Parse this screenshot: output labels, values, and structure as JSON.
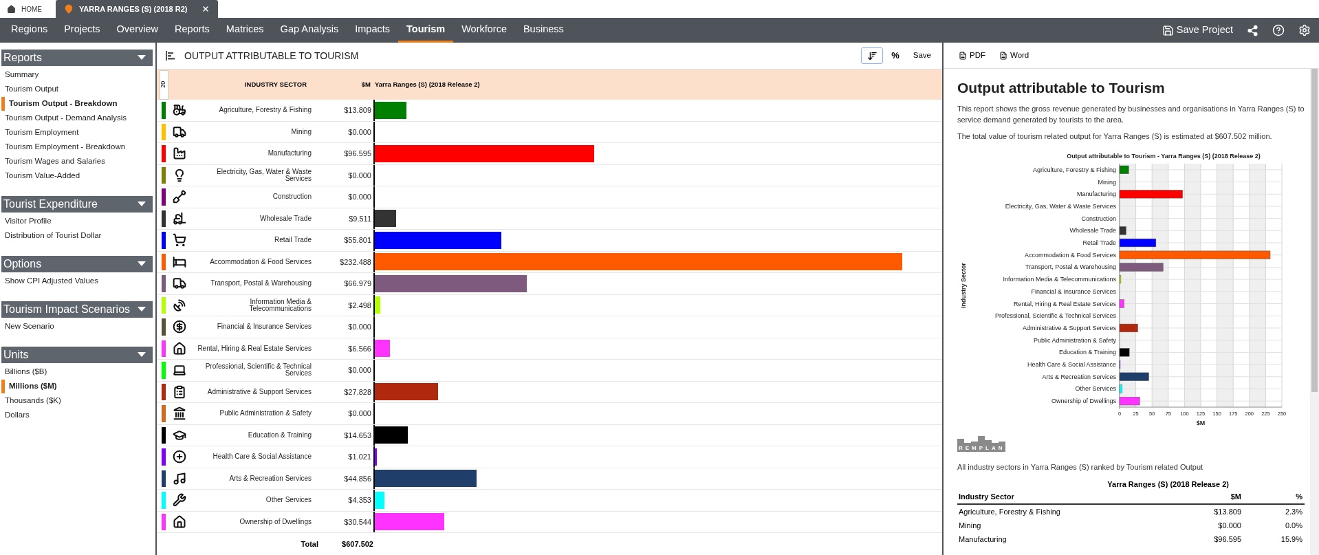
{
  "tabs": [
    {
      "label": "HOME",
      "selected": false
    },
    {
      "label": "YARRA RANGES (S) (2018 R2)",
      "selected": true
    }
  ],
  "nav": {
    "items": [
      {
        "label": "Regions",
        "selected": false
      },
      {
        "label": "Projects",
        "selected": false
      },
      {
        "label": "Overview",
        "selected": false
      },
      {
        "label": "Reports",
        "selected": false
      },
      {
        "label": "Matrices",
        "selected": false
      },
      {
        "label": "Gap Analysis",
        "selected": false
      },
      {
        "label": "Impacts",
        "selected": false
      },
      {
        "label": "Tourism",
        "selected": true
      },
      {
        "label": "Workforce",
        "selected": false
      },
      {
        "label": "Business",
        "selected": false
      }
    ],
    "save_project": "Save Project"
  },
  "sidebar": {
    "sections": [
      {
        "title": "Reports",
        "items": [
          {
            "label": "Summary",
            "selected": false
          },
          {
            "label": "Tourism Output",
            "selected": false
          },
          {
            "label": "Tourism Output - Breakdown",
            "selected": true
          },
          {
            "label": "Tourism Output - Demand Analysis",
            "selected": false
          },
          {
            "label": "Tourism Employment",
            "selected": false
          },
          {
            "label": "Tourism Employment - Breakdown",
            "selected": false
          },
          {
            "label": "Tourism Wages and Salaries",
            "selected": false
          },
          {
            "label": "Tourism Value-Added",
            "selected": false
          }
        ]
      },
      {
        "title": "Tourist Expenditure",
        "items": [
          {
            "label": "Visitor Profile",
            "selected": false
          },
          {
            "label": "Distribution of Tourist Dollar",
            "selected": false
          }
        ]
      },
      {
        "title": "Options",
        "items": [
          {
            "label": "Show CPI Adjusted Values",
            "selected": false
          }
        ]
      },
      {
        "title": "Tourism Impact Scenarios",
        "items": [
          {
            "label": "New Scenario",
            "selected": false
          }
        ]
      },
      {
        "title": "Units",
        "items": [
          {
            "label": "Billions ($B)",
            "selected": false
          },
          {
            "label": "Millions ($M)",
            "selected": true
          },
          {
            "label": "Thousands ($K)",
            "selected": false
          },
          {
            "label": "Dollars",
            "selected": false
          }
        ]
      }
    ]
  },
  "report": {
    "title": "OUTPUT ATTRIBUTABLE TO TOURISM",
    "sort": {
      "selected": true
    },
    "percent": "%",
    "save": "Save",
    "table": {
      "index": "20",
      "columns": [
        "INDUSTRY SECTOR",
        "$M",
        "Yarra Ranges (S) (2018 Release 2)"
      ],
      "rows": [
        {
          "sector": "Agriculture, Forestry & Fishing",
          "value": "$13.809",
          "color": "#008000",
          "level": 0.0552
        },
        {
          "sector": "Mining",
          "value": "$0.000",
          "color": "#ffc000",
          "level": 0
        },
        {
          "sector": "Manufacturing",
          "value": "$96.595",
          "color": "#ff0000",
          "level": 0.3864
        },
        {
          "sector": "Electricity, Gas, Water & Waste Services",
          "value": "$0.000",
          "color": "#808000",
          "level": 0
        },
        {
          "sector": "Construction",
          "value": "$0.000",
          "color": "#800080",
          "level": 0
        },
        {
          "sector": "Wholesale Trade",
          "value": "$9.511",
          "color": "#333333",
          "level": 0.038
        },
        {
          "sector": "Retail Trade",
          "value": "$55.801",
          "color": "#0000ff",
          "level": 0.2232
        },
        {
          "sector": "Accommodation & Food Services",
          "value": "$232.488",
          "color": "#ff5a00",
          "level": 0.93
        },
        {
          "sector": "Transport, Postal & Warehousing",
          "value": "$66.979",
          "color": "#7f5a7f",
          "level": 0.2679
        },
        {
          "sector": "Information Media & Telecommunications",
          "value": "$2.498",
          "color": "#b5ff00",
          "level": 0.01
        },
        {
          "sector": "Financial & Insurance Services",
          "value": "$0.000",
          "color": "#595035",
          "level": 0
        },
        {
          "sector": "Rental, Hiring & Real Estate Services",
          "value": "$6.566",
          "color": "#ff33ff",
          "level": 0.0263
        },
        {
          "sector": "Professional, Scientific & Technical Services",
          "value": "$0.000",
          "color": "#00ff00",
          "level": 0
        },
        {
          "sector": "Administrative & Support Services",
          "value": "$27.828",
          "color": "#b0280e",
          "level": 0.1113
        },
        {
          "sector": "Public Administration & Safety",
          "value": "$0.000",
          "color": "#d2691e",
          "level": 0
        },
        {
          "sector": "Education & Training",
          "value": "$14.653",
          "color": "#000000",
          "level": 0.0586
        },
        {
          "sector": "Health Care & Social Assistance",
          "value": "$1.021",
          "color": "#7f00ff",
          "level": 0.0041
        },
        {
          "sector": "Arts & Recreation Services",
          "value": "$44.856",
          "color": "#1f3f6a",
          "level": 0.1794
        },
        {
          "sector": "Other Services",
          "value": "$4.353",
          "color": "#00ffff",
          "level": 0.0174
        },
        {
          "sector": "Ownership of Dwellings",
          "value": "$30.544",
          "color": "#ff33ff",
          "level": 0.1222
        }
      ],
      "total_label": "Total",
      "total": "$607.502"
    }
  },
  "document": {
    "buttons": [
      "PDF",
      "Word"
    ],
    "title": "Output attributable to Tourism",
    "paragraphs": [
      "This report shows the gross revenue generated by businesses and organisations in Yarra Ranges (S) to service demand generated by tourists to the area.",
      "The total value of tourism related output for Yarra Ranges (S) is estimated at $607.502 million."
    ],
    "chart_data": {
      "type": "bar",
      "orientation": "horizontal",
      "title": "Output attributable to Tourism - Yarra Ranges (S) (2018 Release 2)",
      "xlabel": "$M",
      "ylabel": "Industry Sector",
      "categories": [
        "Agriculture, Forestry & Fishing",
        "Mining",
        "Manufacturing",
        "Electricity, Gas, Water & Waste Services",
        "Construction",
        "Wholesale Trade",
        "Retail Trade",
        "Accommodation & Food Services",
        "Transport, Postal & Warehousing",
        "Information Media & Telecommunications",
        "Financial & Insurance Services",
        "Rental, Hiring & Real Estate Services",
        "Professional, Scientific & Technical Services",
        "Administrative & Support Services",
        "Public Administration & Safety",
        "Education & Training",
        "Health Care & Social Assistance",
        "Arts & Recreation Services",
        "Other Services",
        "Ownership of Dwellings"
      ],
      "series": [
        {
          "values": [
            14,
            0,
            97,
            0,
            0,
            10,
            56,
            232,
            67,
            2,
            0,
            7,
            0,
            28,
            0,
            15,
            1,
            45,
            4,
            31
          ]
        }
      ],
      "xlim": [
        0,
        250
      ],
      "grid": true,
      "xticks": [
        0,
        25,
        50,
        75,
        100,
        125,
        150,
        175,
        200,
        225,
        250
      ]
    },
    "logo": "REMPLAN",
    "caption": "All industry sectors in Yarra Ranges (S) ranked by Tourism related Output",
    "table": {
      "group": "Yarra Ranges (S) (2018 Release 2)",
      "columns": [
        "Industry Sector",
        "$M",
        "%"
      ],
      "rows": [
        [
          "Agriculture, Forestry & Fishing",
          "$13.809",
          "2.3%"
        ],
        [
          "Mining",
          "$0.000",
          "0.0%"
        ],
        [
          "Manufacturing",
          "$96.595",
          "15.9%"
        ]
      ]
    }
  }
}
